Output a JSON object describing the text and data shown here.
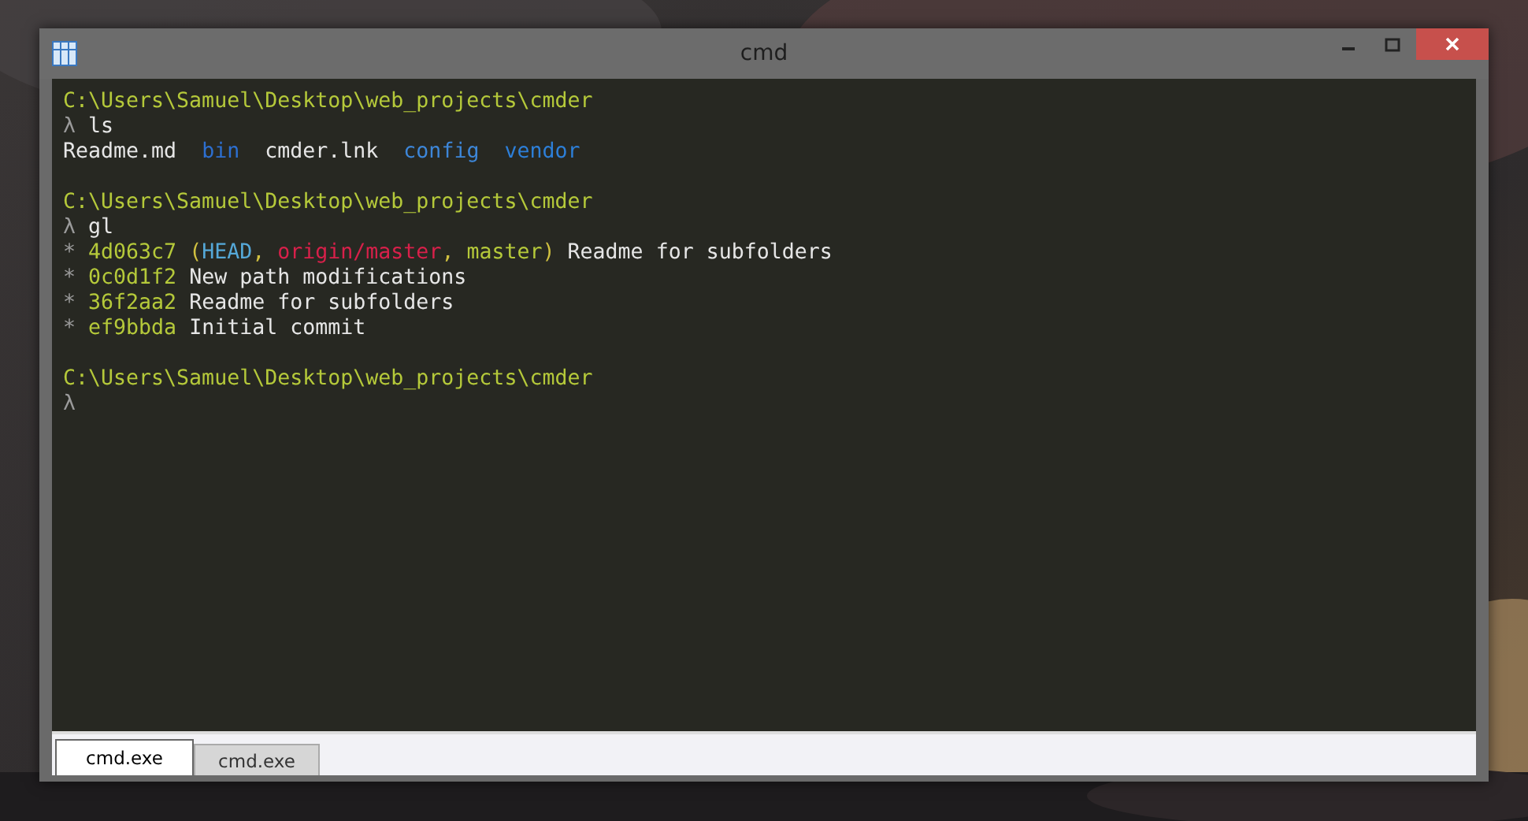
{
  "window": {
    "title": "cmd"
  },
  "terminal": {
    "blocks": [
      {
        "lines": [
          [
            {
              "text": "C:\\Users\\Samuel\\Desktop\\web_projects\\cmder",
              "color": "#b5c93a"
            }
          ],
          [
            {
              "text": "λ ",
              "color": "#9a9a9a"
            },
            {
              "text": "ls",
              "color": "#e6e6e6"
            }
          ],
          [
            {
              "text": "Readme.md  ",
              "color": "#e6e6e6"
            },
            {
              "text": "bin",
              "color": "#2d6fd0"
            },
            {
              "text": "  cmder.lnk  ",
              "color": "#e6e6e6"
            },
            {
              "text": "config",
              "color": "#3d86d8"
            },
            {
              "text": "  vendor",
              "color": "#2d7fd8"
            }
          ]
        ]
      },
      {
        "lines": [
          [
            {
              "text": "C:\\Users\\Samuel\\Desktop\\web_projects\\cmder",
              "color": "#b5c93a"
            }
          ],
          [
            {
              "text": "λ ",
              "color": "#9a9a9a"
            },
            {
              "text": "gl",
              "color": "#e6e6e6"
            }
          ],
          [
            {
              "text": "* ",
              "color": "#9a9a9a"
            },
            {
              "text": "4d063c7 ",
              "color": "#b5c93a"
            },
            {
              "text": "(",
              "color": "#d0c040"
            },
            {
              "text": "HEAD",
              "color": "#55a8d8"
            },
            {
              "text": ", ",
              "color": "#d0c040"
            },
            {
              "text": "origin/master",
              "color": "#d8204a"
            },
            {
              "text": ", ",
              "color": "#d0c040"
            },
            {
              "text": "master",
              "color": "#b5c93a"
            },
            {
              "text": ") ",
              "color": "#d0c040"
            },
            {
              "text": "Readme for subfolders",
              "color": "#e6e6e6"
            }
          ],
          [
            {
              "text": "* ",
              "color": "#9a9a9a"
            },
            {
              "text": "0c0d1f2 ",
              "color": "#b5c93a"
            },
            {
              "text": "New path modifications",
              "color": "#e6e6e6"
            }
          ],
          [
            {
              "text": "* ",
              "color": "#9a9a9a"
            },
            {
              "text": "36f2aa2 ",
              "color": "#b5c93a"
            },
            {
              "text": "Readme for subfolders",
              "color": "#e6e6e6"
            }
          ],
          [
            {
              "text": "* ",
              "color": "#9a9a9a"
            },
            {
              "text": "ef9bbda ",
              "color": "#b5c93a"
            },
            {
              "text": "Initial commit",
              "color": "#e6e6e6"
            }
          ]
        ]
      },
      {
        "lines": [
          [
            {
              "text": "C:\\Users\\Samuel\\Desktop\\web_projects\\cmder",
              "color": "#b5c93a"
            }
          ],
          [
            {
              "text": "λ",
              "color": "#9a9a9a"
            }
          ]
        ]
      }
    ]
  },
  "tabs": [
    {
      "label": "cmd.exe",
      "selected": true
    },
    {
      "label": "cmd.exe",
      "selected": false
    }
  ]
}
